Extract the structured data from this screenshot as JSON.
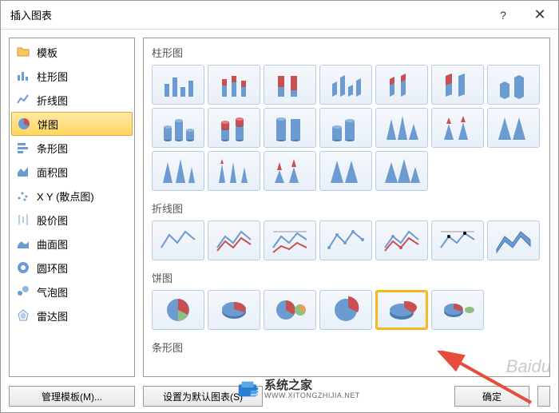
{
  "title": "插入图表",
  "categories": [
    {
      "label": "模板",
      "icon": "folder-icon"
    },
    {
      "label": "柱形图",
      "icon": "column-icon"
    },
    {
      "label": "折线图",
      "icon": "line-icon"
    },
    {
      "label": "饼图",
      "icon": "pie-icon",
      "selected": true
    },
    {
      "label": "条形图",
      "icon": "bar-icon"
    },
    {
      "label": "面积图",
      "icon": "area-icon"
    },
    {
      "label": "X Y (散点图)",
      "icon": "scatter-icon"
    },
    {
      "label": "股价图",
      "icon": "stock-icon"
    },
    {
      "label": "曲面图",
      "icon": "surface-icon"
    },
    {
      "label": "圆环图",
      "icon": "doughnut-icon"
    },
    {
      "label": "气泡图",
      "icon": "bubble-icon"
    },
    {
      "label": "雷达图",
      "icon": "radar-icon"
    }
  ],
  "sections": [
    {
      "header": "柱形图",
      "count": 19
    },
    {
      "header": "折线图",
      "count": 7
    },
    {
      "header": "饼图",
      "count": 6,
      "selectedIndex": 4
    },
    {
      "header": "条形图",
      "count": 0
    }
  ],
  "buttons": {
    "manageTemplates": "管理模板(M)...",
    "setDefault": "设置为默认图表(S)",
    "ok": "确定",
    "cancel": ""
  },
  "brand": {
    "name": "系统之家",
    "url": "WWW.XITONGZHIJIA.NET"
  },
  "watermark": "Baidu"
}
